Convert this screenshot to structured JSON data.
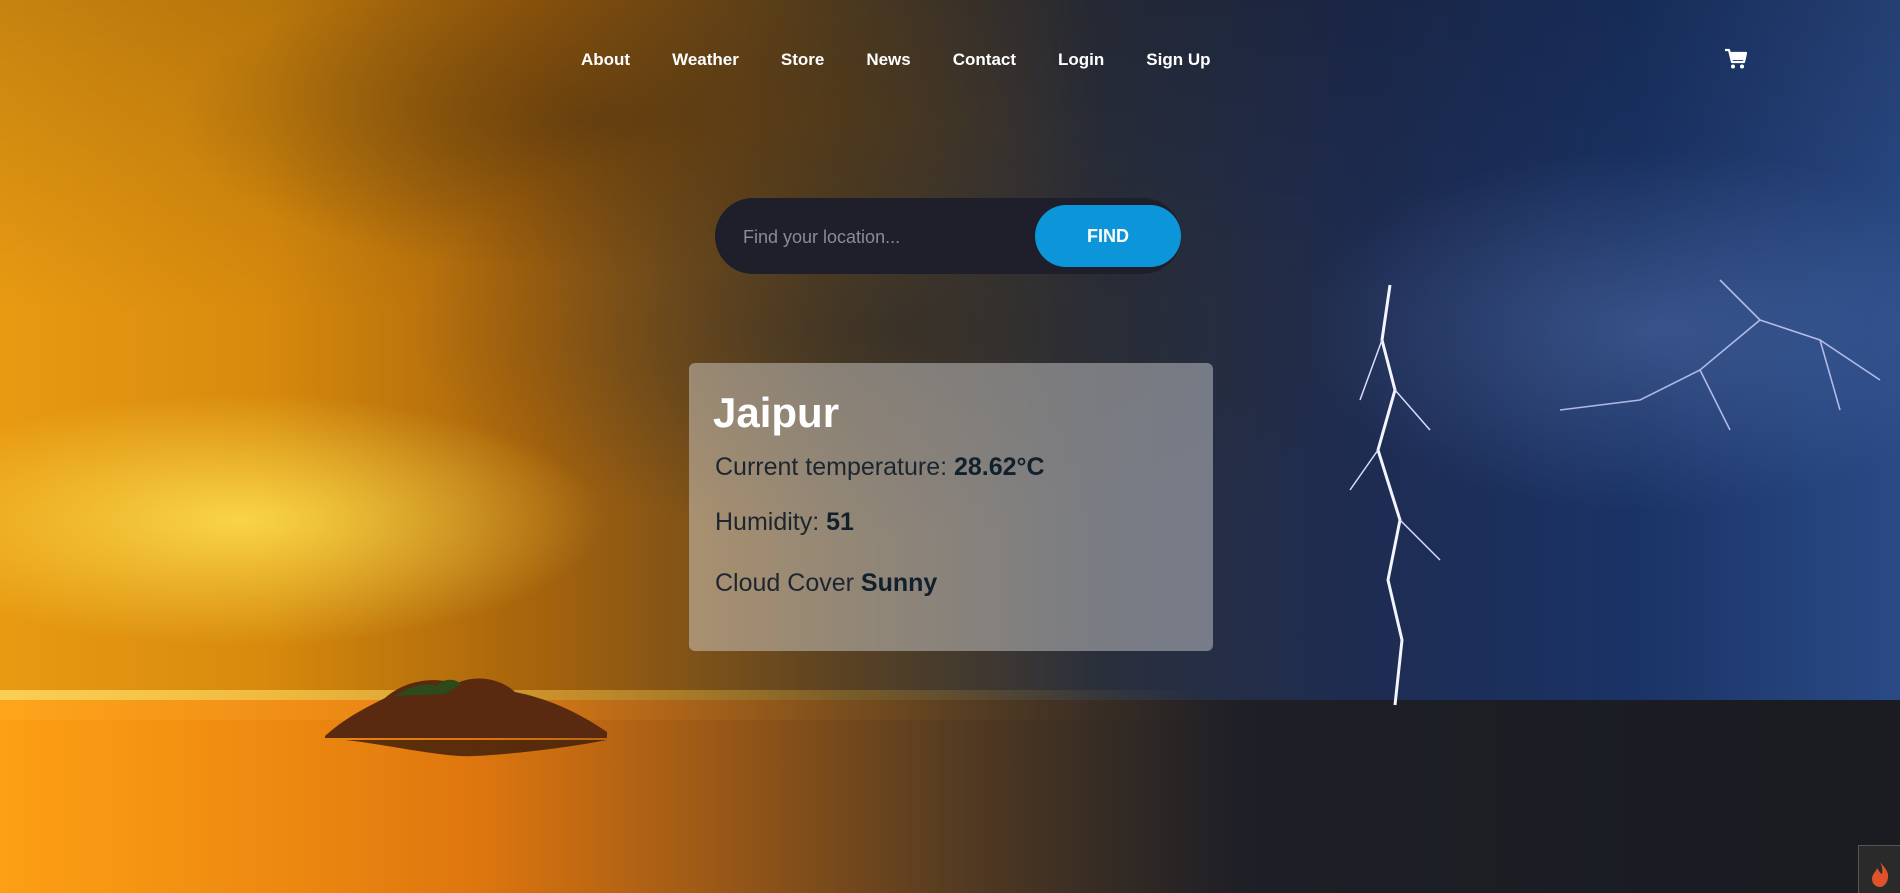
{
  "nav": {
    "items": [
      "About",
      "Weather",
      "Store",
      "News",
      "Contact",
      "Login",
      "Sign Up"
    ],
    "cart_icon": "shopping-cart-icon"
  },
  "search": {
    "placeholder": "Find your location...",
    "value": "",
    "button_label": "FIND"
  },
  "weather": {
    "city": "Jaipur",
    "temperature_label": "Current temperature: ",
    "temperature_value": "28.62°C",
    "humidity_label": "Humidity: ",
    "humidity_value": "51",
    "cloud_label": "Cloud Cover ",
    "cloud_value": "Sunny"
  },
  "colors": {
    "accent": "#0c95d8",
    "search_bg": "#1f1f2b"
  },
  "corner_badge_icon": "flame-icon"
}
